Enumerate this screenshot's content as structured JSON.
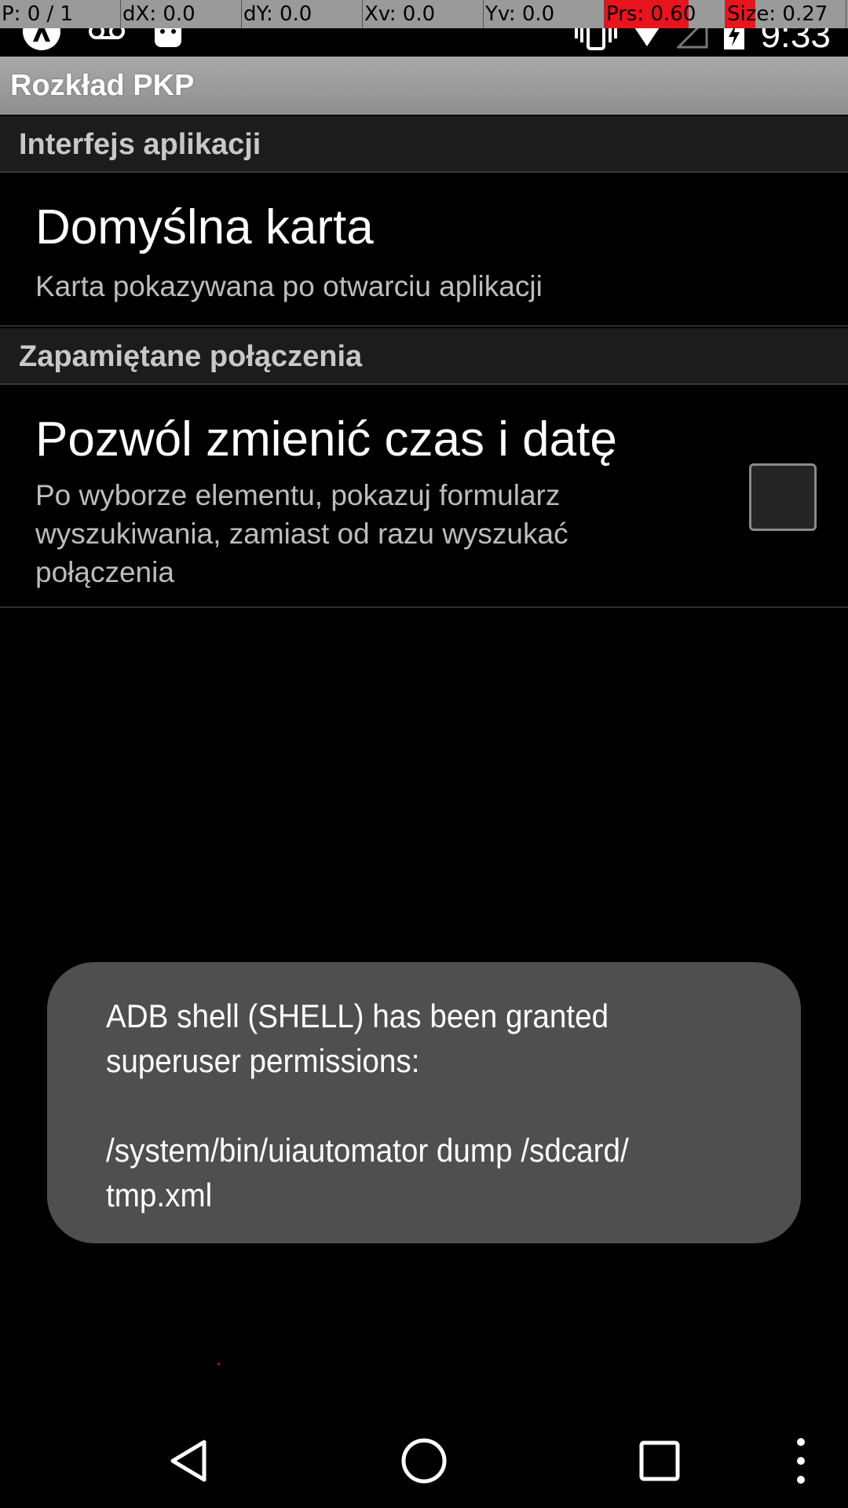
{
  "debug_overlay": {
    "cells": [
      "P: 0 / 1",
      "dX: 0.0",
      "dY: 0.0",
      "Xv: 0.0",
      "Yv: 0.0",
      "Prs: 0.60",
      "Size: 0.27"
    ]
  },
  "status_bar": {
    "time": "9:33",
    "left_icons": [
      "app-notification-icon",
      "voicemail-icon",
      "android-icon"
    ],
    "right_icons": [
      "vibrate-icon",
      "wifi-icon",
      "cell-signal-icon",
      "battery-charging-icon"
    ]
  },
  "action_bar": {
    "title": "Rozkład PKP"
  },
  "preferences": {
    "category_1": "Interfejs aplikacji",
    "item_1": {
      "title": "Domyślna karta",
      "summary": "Karta pokazywana po otwarciu aplikacji"
    },
    "category_2": "Zapamiętane połączenia",
    "item_2": {
      "title": "Pozwól zmienić czas i datę",
      "summary": "Po wyborze elementu, pokazuj formularz wyszukiwania, zamiast od razu wyszukać połączenia",
      "checked": false
    }
  },
  "toast": {
    "message": "ADB shell (SHELL) has been granted superuser permissions:\n\n/system/bin/uiautomator dump /sdcard/\ntmp.xml"
  },
  "nav_bar": {
    "buttons": [
      "back-icon",
      "home-icon",
      "recents-icon",
      "overflow-menu-icon"
    ]
  },
  "colors": {
    "action_bar": "#9a9a9a",
    "category_bg": "#1c1c1c",
    "toast_bg": "#4f4f4f",
    "debug_highlight": "#e8141e"
  }
}
